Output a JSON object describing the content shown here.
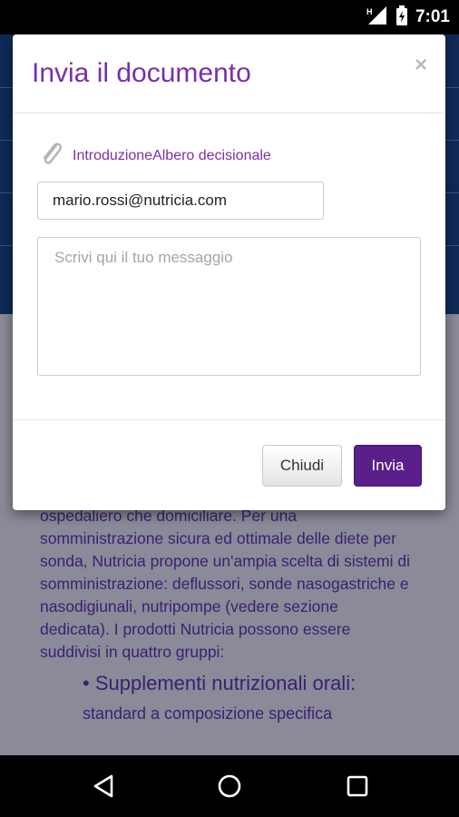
{
  "status_bar": {
    "time": "7:01",
    "icons": [
      "signal-icon",
      "battery-icon"
    ],
    "signal_label": "H"
  },
  "background_page": {
    "paragraph_lines": [
      "ospedaliero che domiciliare. Per una",
      "somministrazione sicura ed ottimale delle diete per",
      "sonda, Nutricia propone un'ampia scelta di sistemi di",
      "somministrazione: deflussori, sonde nasogastriche e",
      "nasodigiunali, nutripompe (vedere sezione",
      "dedicata). I prodotti Nutricia possono essere",
      "suddivisi in quattro gruppi:"
    ],
    "bullet": "• Supplementi nutrizionali orali:",
    "bullet_sub": "standard a composizione specifica"
  },
  "dialog": {
    "title": "Invia il documento",
    "close_glyph": "×",
    "attachment": {
      "icon": "paperclip-icon",
      "label": "IntroduzioneAlbero decisionale"
    },
    "email_value": "mario.rossi@nutricia.com",
    "message_placeholder": "Scrivi qui il tuo messaggio",
    "buttons": {
      "close_label": "Chiudi",
      "send_label": "Invia"
    }
  },
  "nav_bar": {
    "icons": [
      "back-icon",
      "home-icon",
      "recents-icon"
    ]
  },
  "colors": {
    "accent": "#7b2fa7",
    "primary_button": "#5a1f8a",
    "app_header": "#0f2a57",
    "scrim": "#8a8a98"
  }
}
